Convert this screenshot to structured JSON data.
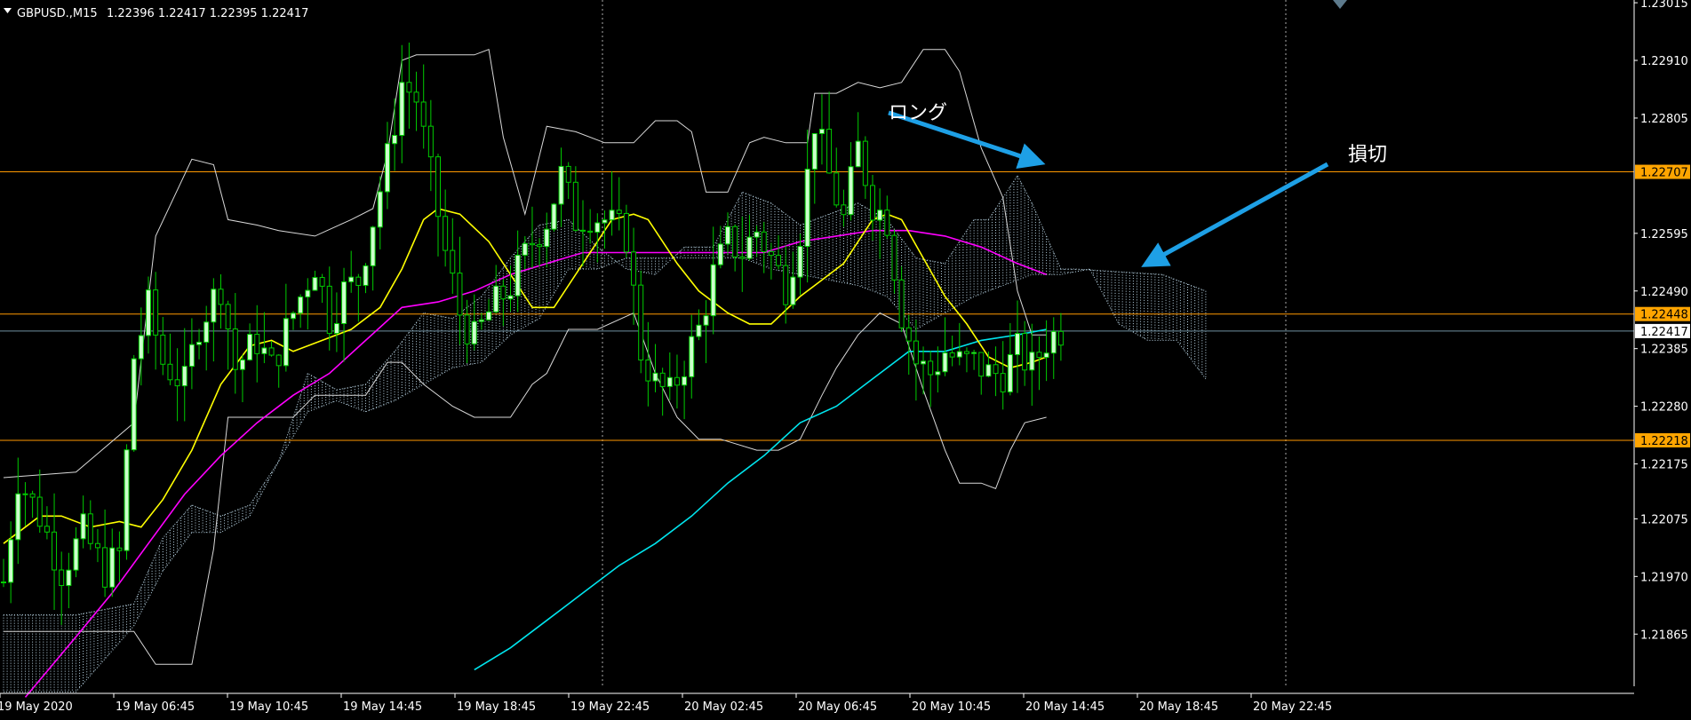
{
  "header": {
    "symbol": "GBPUSD.,M15",
    "ohlc": "1.22396 1.22417 1.22395 1.22417"
  },
  "annotations": {
    "long_label": "ロング",
    "stop_label": "損切"
  },
  "colors": {
    "background": "#000000",
    "bull_body": "#ccffcc",
    "bear_body": "#000000",
    "candle_wick": "#00cc00",
    "bollinger": "#d8d8d8",
    "ma_yellow": "#ffff00",
    "ma_magenta": "#ff00ff",
    "ma_cyan": "#00e5ee",
    "level_line": "#ff9900",
    "level_badge": "#ffa500",
    "current_price_line": "#6f8fa0",
    "ichimoku_cloud": "#bcd8e8",
    "arrow": "#1ea0e6",
    "axis_text": "#ffffff"
  },
  "chart_data": {
    "type": "candlestick",
    "symbol": "GBPUSD.",
    "timeframe": "M15",
    "ylim": [
      1.2177,
      1.2302
    ],
    "y_ticks": [
      "1.23015",
      "1.22910",
      "1.22805",
      "1.22595",
      "1.22490",
      "1.22385",
      "1.22280",
      "1.22175",
      "1.22075",
      "1.21970",
      "1.21865"
    ],
    "x_ticks": [
      "19 May 2020",
      "19 May 06:45",
      "19 May 10:45",
      "19 May 14:45",
      "19 May 18:45",
      "19 May 22:45",
      "20 May 02:45",
      "20 May 06:45",
      "20 May 10:45",
      "20 May 14:45",
      "20 May 18:45",
      "20 May 22:45"
    ],
    "price_levels": [
      {
        "value": 1.22707,
        "label": "1.22707"
      },
      {
        "value": 1.22448,
        "label": "1.22448"
      },
      {
        "value": 1.22218,
        "label": "1.22218"
      }
    ],
    "current_price": {
      "value": 1.22417,
      "label": "1.22417"
    },
    "price_path": [
      [
        0,
        1.2196
      ],
      [
        2,
        1.2215
      ],
      [
        5,
        1.2208
      ],
      [
        8,
        1.2198
      ],
      [
        11,
        1.2205
      ],
      [
        14,
        1.2198
      ],
      [
        16,
        1.2201
      ],
      [
        18,
        1.2237
      ],
      [
        20,
        1.2246
      ],
      [
        22,
        1.2236
      ],
      [
        25,
        1.2232
      ],
      [
        27,
        1.2243
      ],
      [
        30,
        1.225
      ],
      [
        32,
        1.2235
      ],
      [
        35,
        1.224
      ],
      [
        37,
        1.2235
      ],
      [
        40,
        1.2245
      ],
      [
        43,
        1.2254
      ],
      [
        45,
        1.2244
      ],
      [
        47,
        1.2249
      ],
      [
        49,
        1.2251
      ],
      [
        51,
        1.2262
      ],
      [
        53,
        1.2273
      ],
      [
        55,
        1.2287
      ],
      [
        57,
        1.2284
      ],
      [
        59,
        1.227
      ],
      [
        61,
        1.2256
      ],
      [
        63,
        1.2245
      ],
      [
        65,
        1.224
      ],
      [
        67,
        1.2245
      ],
      [
        70,
        1.225
      ],
      [
        73,
        1.2258
      ],
      [
        75,
        1.2262
      ],
      [
        77,
        1.227
      ],
      [
        79,
        1.2262
      ],
      [
        81,
        1.2263
      ],
      [
        83,
        1.2262
      ],
      [
        86,
        1.2259
      ],
      [
        88,
        1.2238
      ],
      [
        90,
        1.2232
      ],
      [
        92,
        1.223
      ],
      [
        94,
        1.2236
      ],
      [
        96,
        1.2242
      ],
      [
        98,
        1.2252
      ],
      [
        100,
        1.2258
      ],
      [
        102,
        1.2256
      ],
      [
        104,
        1.226
      ],
      [
        106,
        1.2255
      ],
      [
        108,
        1.225
      ],
      [
        110,
        1.226
      ],
      [
        112,
        1.228
      ],
      [
        114,
        1.227
      ],
      [
        116,
        1.2262
      ],
      [
        118,
        1.2275
      ],
      [
        120,
        1.2265
      ],
      [
        122,
        1.2262
      ],
      [
        124,
        1.2245
      ],
      [
        126,
        1.2236
      ],
      [
        128,
        1.2234
      ],
      [
        130,
        1.2238
      ],
      [
        132,
        1.2236
      ],
      [
        134,
        1.2236
      ],
      [
        136,
        1.2234
      ],
      [
        138,
        1.2234
      ],
      [
        140,
        1.2238
      ],
      [
        142,
        1.2235
      ],
      [
        144,
        1.224
      ],
      [
        146,
        1.2242
      ]
    ],
    "bollinger_upper": [
      [
        0,
        1.2215
      ],
      [
        10,
        1.2216
      ],
      [
        18,
        1.2225
      ],
      [
        21,
        1.2259
      ],
      [
        26,
        1.2273
      ],
      [
        29,
        1.2272
      ],
      [
        31,
        1.2262
      ],
      [
        35,
        1.2261
      ],
      [
        38,
        1.226
      ],
      [
        43,
        1.2259
      ],
      [
        48,
        1.2262
      ],
      [
        51,
        1.2264
      ],
      [
        53,
        1.2274
      ],
      [
        55,
        1.2291
      ],
      [
        57,
        1.2292
      ],
      [
        62,
        1.2292
      ],
      [
        65,
        1.2292
      ],
      [
        67,
        1.2293
      ],
      [
        69,
        1.2277
      ],
      [
        72,
        1.2263
      ],
      [
        75,
        1.2279
      ],
      [
        79,
        1.2278
      ],
      [
        83,
        1.2276
      ],
      [
        87,
        1.2276
      ],
      [
        90,
        1.228
      ],
      [
        93,
        1.228
      ],
      [
        95,
        1.2278
      ],
      [
        97,
        1.2267
      ],
      [
        100,
        1.2267
      ],
      [
        103,
        1.2276
      ],
      [
        105,
        1.2277
      ],
      [
        108,
        1.2276
      ],
      [
        111,
        1.2276
      ],
      [
        112,
        1.2285
      ],
      [
        115,
        1.2285
      ],
      [
        118,
        1.2287
      ],
      [
        121,
        1.2286
      ],
      [
        124,
        1.2287
      ],
      [
        127,
        1.2293
      ],
      [
        130,
        1.2293
      ],
      [
        132,
        1.2289
      ],
      [
        135,
        1.2275
      ],
      [
        138,
        1.2266
      ],
      [
        140,
        1.2249
      ],
      [
        142,
        1.2241
      ],
      [
        144,
        1.2241
      ]
    ],
    "bollinger_lower": [
      [
        0,
        1.2187
      ],
      [
        18,
        1.2187
      ],
      [
        21,
        1.2181
      ],
      [
        26,
        1.2181
      ],
      [
        29,
        1.2202
      ],
      [
        31,
        1.2226
      ],
      [
        35,
        1.2226
      ],
      [
        40,
        1.2226
      ],
      [
        43,
        1.223
      ],
      [
        50,
        1.223
      ],
      [
        53,
        1.2236
      ],
      [
        55,
        1.2236
      ],
      [
        58,
        1.2232
      ],
      [
        62,
        1.2228
      ],
      [
        65,
        1.2226
      ],
      [
        70,
        1.2226
      ],
      [
        73,
        1.2232
      ],
      [
        75,
        1.2234
      ],
      [
        78,
        1.2242
      ],
      [
        82,
        1.2242
      ],
      [
        87,
        1.2245
      ],
      [
        90,
        1.2234
      ],
      [
        93,
        1.2226
      ],
      [
        96,
        1.2222
      ],
      [
        99,
        1.2222
      ],
      [
        104,
        1.222
      ],
      [
        107,
        1.222
      ],
      [
        110,
        1.2222
      ],
      [
        113,
        1.223
      ],
      [
        115,
        1.2235
      ],
      [
        118,
        1.2241
      ],
      [
        121,
        1.2245
      ],
      [
        124,
        1.2243
      ],
      [
        127,
        1.2231
      ],
      [
        130,
        1.222
      ],
      [
        132,
        1.2214
      ],
      [
        135,
        1.2214
      ],
      [
        137,
        1.2213
      ],
      [
        139,
        1.222
      ],
      [
        141,
        1.2225
      ],
      [
        144,
        1.2226
      ]
    ],
    "ma_yellow": [
      [
        0,
        1.2203
      ],
      [
        5,
        1.2208
      ],
      [
        8,
        1.2208
      ],
      [
        12,
        1.2206
      ],
      [
        16,
        1.2207
      ],
      [
        19,
        1.2206
      ],
      [
        22,
        1.2211
      ],
      [
        26,
        1.222
      ],
      [
        30,
        1.2232
      ],
      [
        34,
        1.2239
      ],
      [
        37,
        1.224
      ],
      [
        40,
        1.2238
      ],
      [
        44,
        1.224
      ],
      [
        48,
        1.2242
      ],
      [
        52,
        1.2246
      ],
      [
        55,
        1.2253
      ],
      [
        58,
        1.2262
      ],
      [
        60,
        1.2264
      ],
      [
        63,
        1.2263
      ],
      [
        67,
        1.2258
      ],
      [
        70,
        1.2252
      ],
      [
        73,
        1.2246
      ],
      [
        76,
        1.2246
      ],
      [
        80,
        1.2254
      ],
      [
        84,
        1.2262
      ],
      [
        87,
        1.2263
      ],
      [
        89,
        1.2262
      ],
      [
        93,
        1.2254
      ],
      [
        96,
        1.2249
      ],
      [
        100,
        1.2245
      ],
      [
        103,
        1.2243
      ],
      [
        106,
        1.2243
      ],
      [
        110,
        1.2248
      ],
      [
        113,
        1.2251
      ],
      [
        116,
        1.2254
      ],
      [
        120,
        1.2262
      ],
      [
        122,
        1.2263
      ],
      [
        124,
        1.2262
      ],
      [
        127,
        1.2255
      ],
      [
        130,
        1.2248
      ],
      [
        133,
        1.2243
      ],
      [
        136,
        1.2237
      ],
      [
        139,
        1.2235
      ],
      [
        142,
        1.2236
      ],
      [
        144,
        1.2237
      ]
    ],
    "ma_magenta": [
      [
        3,
        1.2175
      ],
      [
        10,
        1.2186
      ],
      [
        15,
        1.2194
      ],
      [
        20,
        1.2203
      ],
      [
        25,
        1.2212
      ],
      [
        30,
        1.2219
      ],
      [
        35,
        1.2225
      ],
      [
        40,
        1.223
      ],
      [
        45,
        1.2234
      ],
      [
        50,
        1.224
      ],
      [
        55,
        1.2246
      ],
      [
        60,
        1.2247
      ],
      [
        65,
        1.2249
      ],
      [
        70,
        1.2252
      ],
      [
        75,
        1.2254
      ],
      [
        80,
        1.2256
      ],
      [
        85,
        1.2256
      ],
      [
        90,
        1.2256
      ],
      [
        95,
        1.2256
      ],
      [
        100,
        1.2256
      ],
      [
        105,
        1.2256
      ],
      [
        110,
        1.2258
      ],
      [
        115,
        1.2259
      ],
      [
        120,
        1.226
      ],
      [
        125,
        1.226
      ],
      [
        130,
        1.2259
      ],
      [
        135,
        1.2257
      ],
      [
        140,
        1.2254
      ],
      [
        144,
        1.2252
      ]
    ],
    "ma_cyan": [
      [
        65,
        1.218
      ],
      [
        70,
        1.2184
      ],
      [
        75,
        1.2189
      ],
      [
        80,
        1.2194
      ],
      [
        85,
        1.2199
      ],
      [
        90,
        1.2203
      ],
      [
        95,
        1.2208
      ],
      [
        100,
        1.2214
      ],
      [
        105,
        1.2219
      ],
      [
        110,
        1.2225
      ],
      [
        115,
        1.2228
      ],
      [
        120,
        1.2233
      ],
      [
        125,
        1.2238
      ],
      [
        130,
        1.2238
      ],
      [
        135,
        1.224
      ],
      [
        140,
        1.2241
      ],
      [
        144,
        1.2242
      ]
    ],
    "ichimoku_cloud_a": [
      [
        0,
        1.219
      ],
      [
        10,
        1.219
      ],
      [
        18,
        1.2192
      ],
      [
        22,
        1.2204
      ],
      [
        26,
        1.221
      ],
      [
        30,
        1.2208
      ],
      [
        34,
        1.221
      ],
      [
        38,
        1.2218
      ],
      [
        42,
        1.2234
      ],
      [
        46,
        1.2231
      ],
      [
        50,
        1.2232
      ],
      [
        54,
        1.2238
      ],
      [
        58,
        1.2245
      ],
      [
        62,
        1.2244
      ],
      [
        66,
        1.2248
      ],
      [
        70,
        1.2255
      ],
      [
        74,
        1.2261
      ],
      [
        78,
        1.2262
      ],
      [
        82,
        1.2257
      ],
      [
        86,
        1.2253
      ],
      [
        90,
        1.2252
      ],
      [
        94,
        1.2257
      ],
      [
        98,
        1.2257
      ],
      [
        102,
        1.2267
      ],
      [
        106,
        1.2265
      ],
      [
        110,
        1.2261
      ],
      [
        114,
        1.2263
      ],
      [
        118,
        1.2265
      ],
      [
        122,
        1.2262
      ],
      [
        126,
        1.2255
      ],
      [
        130,
        1.2254
      ],
      [
        134,
        1.2262
      ],
      [
        136,
        1.2262
      ],
      [
        140,
        1.227
      ],
      [
        142,
        1.2265
      ],
      [
        146,
        1.2253
      ],
      [
        148,
        1.2253
      ],
      [
        160,
        1.2252
      ],
      [
        166,
        1.2249
      ]
    ],
    "ichimoku_cloud_b": [
      [
        0,
        1.2176
      ],
      [
        10,
        1.2176
      ],
      [
        18,
        1.2188
      ],
      [
        22,
        1.2198
      ],
      [
        26,
        1.2205
      ],
      [
        30,
        1.2205
      ],
      [
        34,
        1.2208
      ],
      [
        38,
        1.2218
      ],
      [
        42,
        1.2227
      ],
      [
        46,
        1.2229
      ],
      [
        50,
        1.2227
      ],
      [
        54,
        1.2229
      ],
      [
        58,
        1.2232
      ],
      [
        62,
        1.2235
      ],
      [
        66,
        1.2236
      ],
      [
        70,
        1.2241
      ],
      [
        74,
        1.2244
      ],
      [
        78,
        1.2253
      ],
      [
        82,
        1.2253
      ],
      [
        86,
        1.2255
      ],
      [
        90,
        1.2255
      ],
      [
        94,
        1.2255
      ],
      [
        98,
        1.2255
      ],
      [
        102,
        1.2255
      ],
      [
        106,
        1.2253
      ],
      [
        110,
        1.2252
      ],
      [
        114,
        1.2251
      ],
      [
        118,
        1.225
      ],
      [
        122,
        1.2248
      ],
      [
        126,
        1.2242
      ],
      [
        130,
        1.2245
      ],
      [
        134,
        1.2248
      ],
      [
        138,
        1.225
      ],
      [
        142,
        1.2252
      ],
      [
        146,
        1.2252
      ],
      [
        150,
        1.2253
      ],
      [
        154,
        1.2243
      ],
      [
        158,
        1.224
      ],
      [
        162,
        1.224
      ],
      [
        166,
        1.2233
      ]
    ],
    "annotations": [
      {
        "text": "ロング",
        "meaning": "long entry"
      },
      {
        "text": "損切",
        "meaning": "stop loss"
      }
    ]
  }
}
